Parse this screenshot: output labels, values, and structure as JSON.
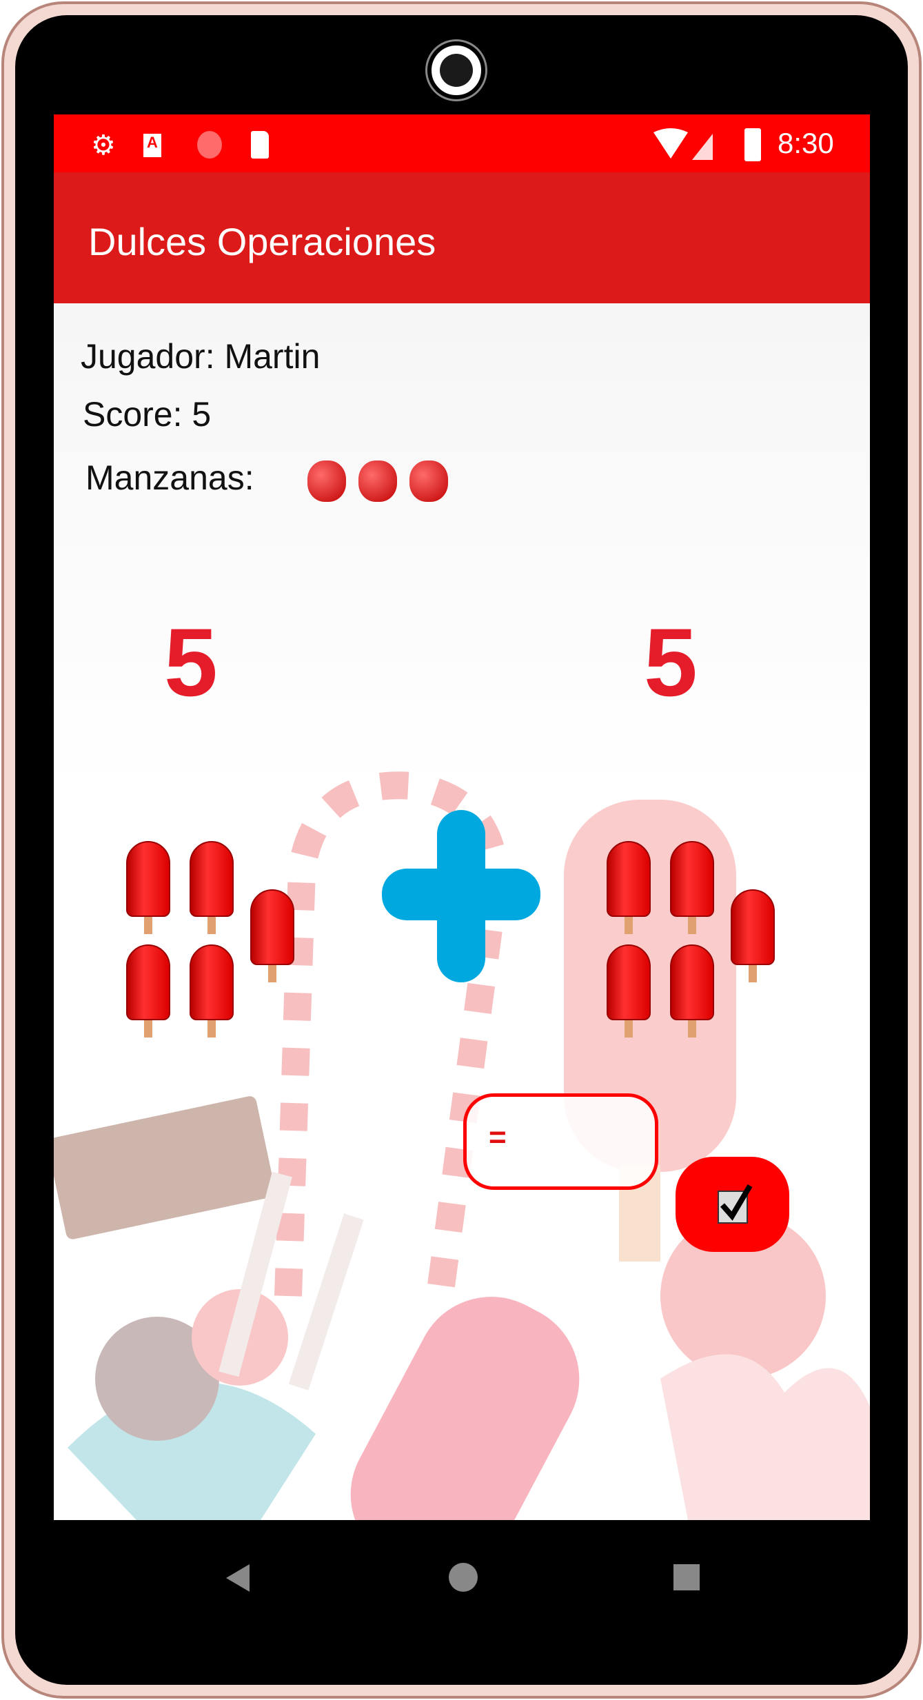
{
  "status_bar": {
    "time": "8:30",
    "icons": [
      "gear-icon",
      "text-a-icon",
      "record-icon",
      "sd-card-icon",
      "wifi-icon",
      "signal-icon",
      "battery-icon"
    ]
  },
  "app_bar": {
    "title": "Dulces Operaciones"
  },
  "player": {
    "label": "Jugador: Martin",
    "score": "Score: 5",
    "apples_label": "Manzanas:",
    "apples": 3
  },
  "operation": {
    "left_number": "5",
    "operator": "+",
    "right_number": "5",
    "left_popsicles": 5,
    "right_popsicles": 5
  },
  "answer": {
    "prefix": "=",
    "value": ""
  },
  "colors": {
    "status": "#ff0000",
    "appbar": "#dc1a1a",
    "operator": "#00a8e0",
    "accent": "#ff0000"
  }
}
